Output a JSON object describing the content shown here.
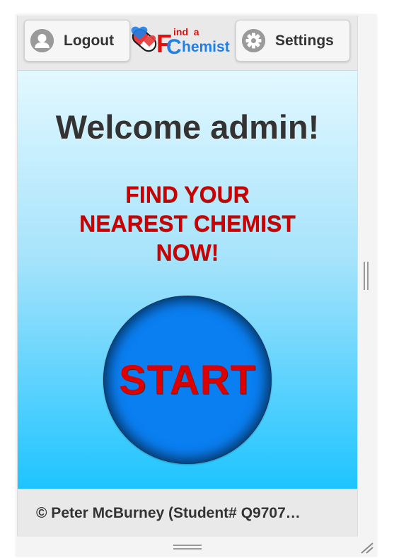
{
  "header": {
    "logout_label": "Logout",
    "settings_label": "Settings",
    "logo": {
      "letter_f": "F",
      "letter_c": "C",
      "text_top": "ind  a",
      "text_bottom": "hemist"
    }
  },
  "main": {
    "welcome": "Welcome admin!",
    "tagline_lines": [
      "FIND YOUR",
      "NEAREST CHEMIST",
      "NOW!"
    ],
    "start_label": "START"
  },
  "footer": {
    "text": "© Peter McBurney (Student# Q9707…"
  },
  "colors": {
    "accent_red": "#cc0000",
    "start_blue": "#0a7ff2",
    "logo_blue": "#1e7fe6",
    "gradient_top": "#e2f8ff",
    "gradient_bottom": "#1ec4ff"
  },
  "icons": {
    "logout": "user-silhouette-icon",
    "settings": "gear-icon",
    "logo": "pill-capsule-icon"
  }
}
